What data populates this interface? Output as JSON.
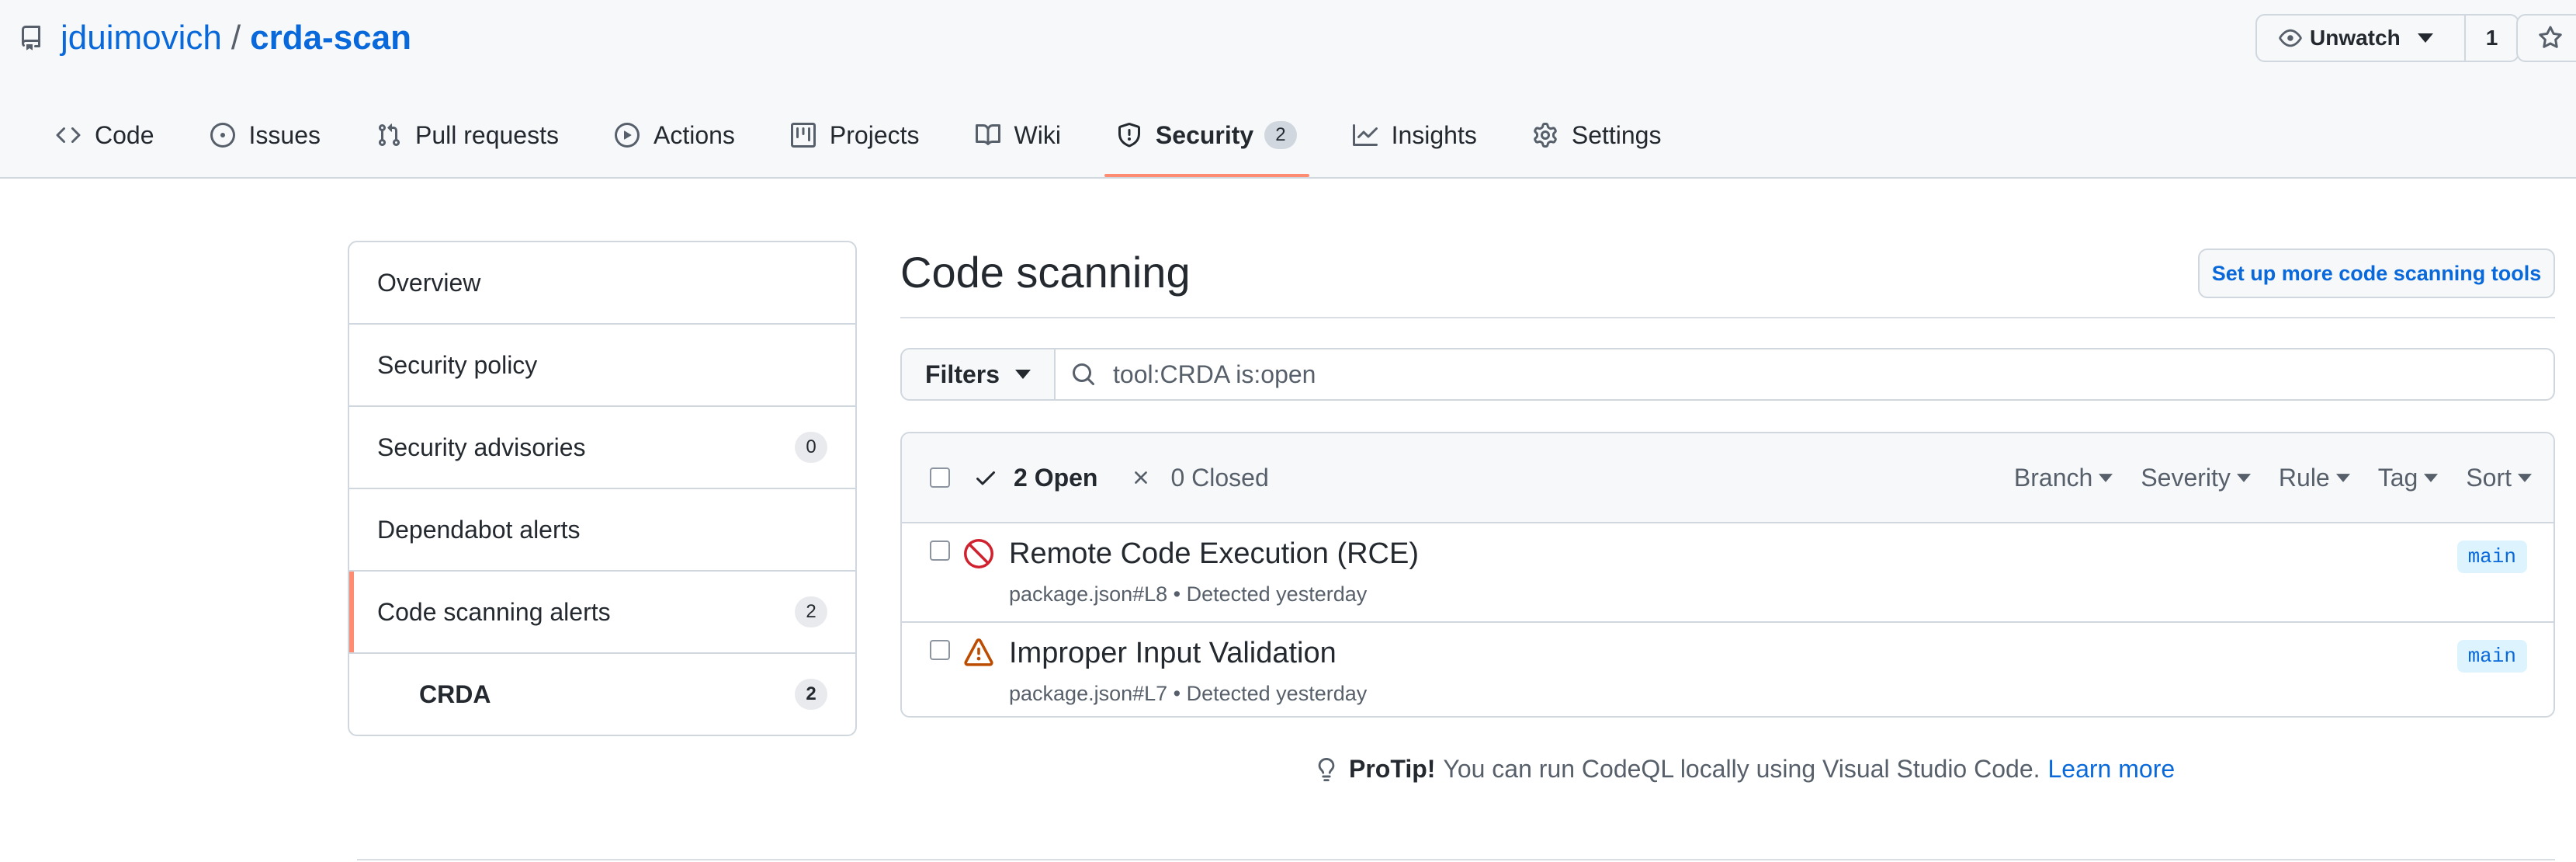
{
  "repo": {
    "owner": "jduimovich",
    "separator": "/",
    "name": "crda-scan"
  },
  "watch": {
    "label": "Unwatch",
    "count": "1"
  },
  "tabs": [
    {
      "label": "Code",
      "icon": "code-icon"
    },
    {
      "label": "Issues",
      "icon": "issue-icon"
    },
    {
      "label": "Pull requests",
      "icon": "pull-request-icon"
    },
    {
      "label": "Actions",
      "icon": "play-icon"
    },
    {
      "label": "Projects",
      "icon": "project-icon"
    },
    {
      "label": "Wiki",
      "icon": "book-icon"
    },
    {
      "label": "Security",
      "icon": "shield-icon",
      "counter": "2",
      "active": true
    },
    {
      "label": "Insights",
      "icon": "graph-icon"
    },
    {
      "label": "Settings",
      "icon": "gear-icon"
    }
  ],
  "sidebar": {
    "items": [
      {
        "label": "Overview"
      },
      {
        "label": "Security policy"
      },
      {
        "label": "Security advisories",
        "count": "0"
      },
      {
        "label": "Dependabot alerts"
      },
      {
        "label": "Code scanning alerts",
        "count": "2",
        "selected": true
      },
      {
        "label": "CRDA",
        "count": "2"
      }
    ]
  },
  "main": {
    "title": "Code scanning",
    "setup_button": "Set up more code scanning tools",
    "filters_label": "Filters",
    "search_value": "tool:CRDA is:open",
    "open_label": "2 Open",
    "closed_label": "0 Closed",
    "head_filters": [
      "Branch",
      "Severity",
      "Rule",
      "Tag",
      "Sort"
    ],
    "alerts": [
      {
        "title": "Remote Code Execution (RCE)",
        "meta": "package.json#L8 • Detected yesterday",
        "branch": "main",
        "severity_icon": "stop-icon"
      },
      {
        "title": "Improper Input Validation",
        "meta": "package.json#L7 • Detected yesterday",
        "branch": "main",
        "severity_icon": "alert-icon"
      }
    ]
  },
  "protip": {
    "label": "ProTip!",
    "text": "You can run CodeQL locally using Visual Studio Code.",
    "link": "Learn more"
  },
  "colors": {
    "accent_underline": "#fd8c73",
    "link": "#0969da",
    "error": "#cf222e",
    "warning": "#bc4c00"
  }
}
